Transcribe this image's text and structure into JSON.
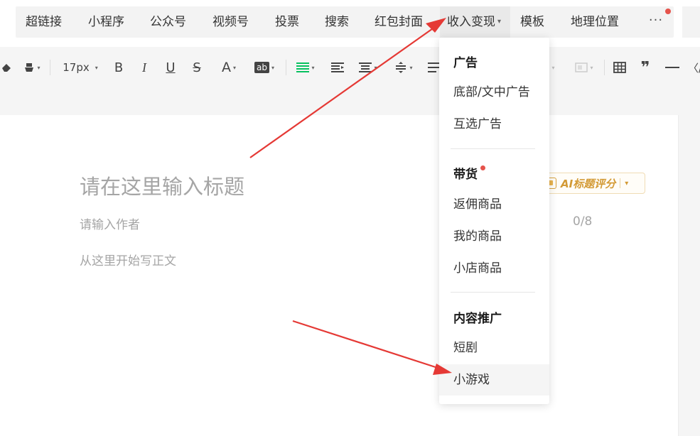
{
  "insert_bar": {
    "items": [
      {
        "label": "超链接"
      },
      {
        "label": "小程序"
      },
      {
        "label": "公众号"
      },
      {
        "label": "视频号"
      },
      {
        "label": "投票"
      },
      {
        "label": "搜索"
      },
      {
        "label": "红包封面"
      },
      {
        "label": "收入变现",
        "has_caret": true,
        "active": true
      },
      {
        "label": "模板"
      },
      {
        "label": "地理位置"
      }
    ],
    "more_label": "···",
    "notification_color": "#e5534b"
  },
  "toolbar": {
    "font_size": "17px",
    "icons": [
      "eraser-icon",
      "format-painter-icon",
      "bold-icon",
      "italic-icon",
      "underline-icon",
      "strikethrough-icon",
      "font-color-icon",
      "background-color-icon",
      "align-left-icon",
      "indent-icon",
      "align-center-icon",
      "line-height-icon",
      "list-icon",
      "table-icon",
      "quote-icon",
      "divider-icon",
      "code-icon"
    ],
    "bold_label": "B",
    "italic_label": "I",
    "underline_label": "U",
    "strike_label": "S",
    "font_color_label": "A",
    "bg_color_label": "ab",
    "quote_label": "❞",
    "code_label": "〈/",
    "accent_color": "#07c160"
  },
  "editor": {
    "title_placeholder": "请在这里输入标题",
    "author_placeholder": "请输入作者",
    "author_count": "0/8",
    "body_placeholder": "从这里开始写正文",
    "ai_button_label": "AI标题评分",
    "ai_color": "#d39a35"
  },
  "dropdown": {
    "sections": [
      {
        "header": "广告",
        "items": [
          "底部/文中广告",
          "互选广告"
        ]
      },
      {
        "header": "带货",
        "has_dot": true,
        "items": [
          "返佣商品",
          "我的商品",
          "小店商品"
        ]
      },
      {
        "header": "内容推广",
        "items": [
          "短剧",
          "小游戏"
        ]
      }
    ],
    "hovered_item": "小游戏"
  },
  "annotation_color": "#e53935"
}
